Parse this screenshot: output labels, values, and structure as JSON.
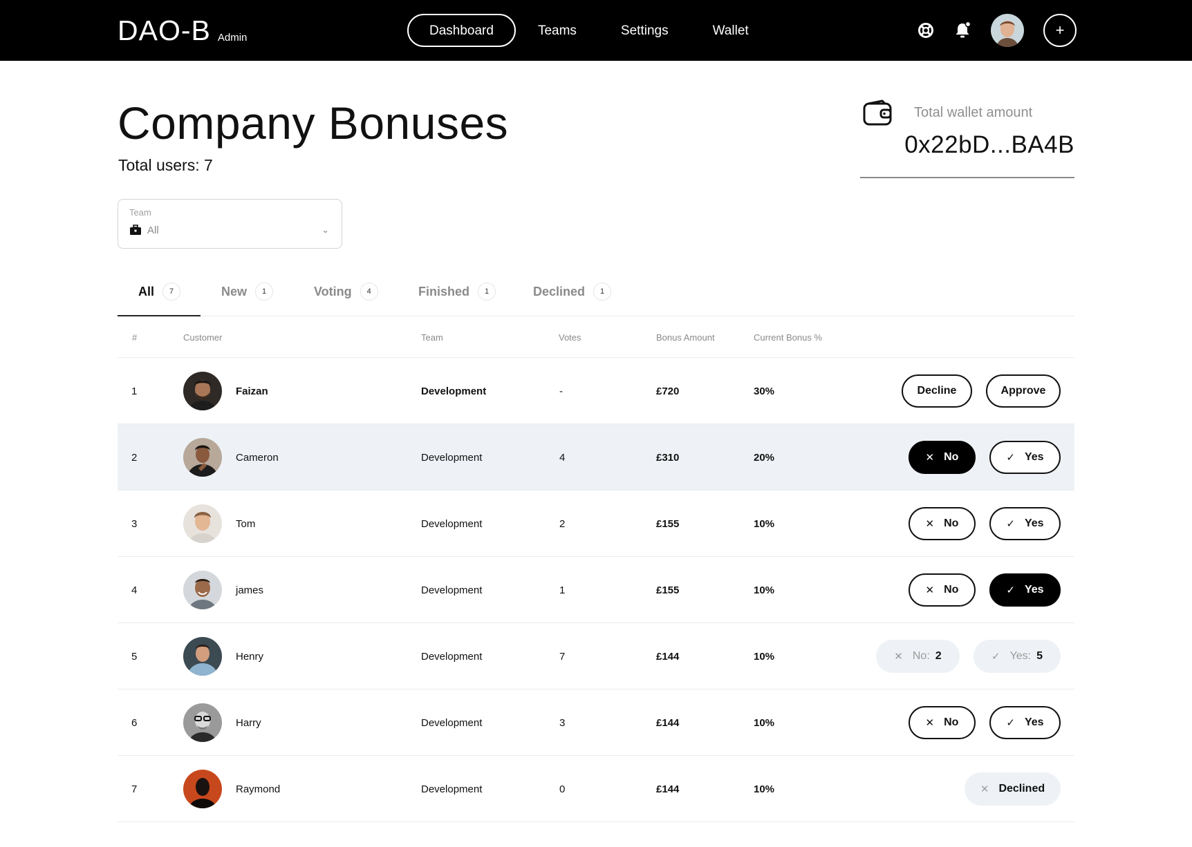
{
  "nav": {
    "logo": "DAO-B",
    "logo_sub": "Admin",
    "items": [
      {
        "label": "Dashboard",
        "active": true
      },
      {
        "label": "Teams"
      },
      {
        "label": "Settings"
      },
      {
        "label": "Wallet"
      }
    ],
    "plus": "+"
  },
  "page": {
    "title": "Company Bonuses",
    "total_users": "Total users: 7"
  },
  "wallet": {
    "label": "Total wallet amount",
    "value": "0x22bD...BA4B"
  },
  "filter": {
    "label": "Team",
    "value": "All",
    "chevron": "⌄"
  },
  "tabs": [
    {
      "label": "All",
      "count": "7",
      "active": true
    },
    {
      "label": "New",
      "count": "1"
    },
    {
      "label": "Voting",
      "count": "4"
    },
    {
      "label": "Finished",
      "count": "1"
    },
    {
      "label": "Declined",
      "count": "1"
    }
  ],
  "table": {
    "headers": [
      "#",
      "Customer",
      "Team",
      "Votes",
      "Bonus Amount",
      "Current Bonus %"
    ],
    "rows": [
      {
        "num": "1",
        "name": "Faizan",
        "team": "Development",
        "votes": "-",
        "amount": "£720",
        "pct": "30%",
        "name_bold": true,
        "action": "decision",
        "decline": "Decline",
        "approve": "Approve"
      },
      {
        "num": "2",
        "name": "Cameron",
        "team": "Development",
        "votes": "4",
        "amount": "£310",
        "pct": "20%",
        "highlight": true,
        "action": "vote",
        "selected": "no",
        "no": "No",
        "yes": "Yes"
      },
      {
        "num": "3",
        "name": "Tom",
        "team": "Development",
        "votes": "2",
        "amount": "£155",
        "pct": "10%",
        "action": "vote",
        "selected": "none",
        "no": "No",
        "yes": "Yes"
      },
      {
        "num": "4",
        "name": "james",
        "team": "Development",
        "votes": "1",
        "amount": "£155",
        "pct": "10%",
        "action": "vote",
        "selected": "yes",
        "no": "No",
        "yes": "Yes"
      },
      {
        "num": "5",
        "name": "Henry",
        "team": "Development",
        "votes": "7",
        "amount": "£144",
        "pct": "10%",
        "action": "result",
        "no": "No:",
        "no_count": "2",
        "yes": "Yes:",
        "yes_count": "5"
      },
      {
        "num": "6",
        "name": "Harry",
        "team": "Development",
        "votes": "3",
        "amount": "£144",
        "pct": "10%",
        "action": "vote",
        "selected": "none",
        "no": "No",
        "yes": "Yes"
      },
      {
        "num": "7",
        "name": "Raymond",
        "team": "Development",
        "votes": "0",
        "amount": "£144",
        "pct": "10%",
        "action": "declined",
        "declined": "Declined"
      }
    ]
  },
  "colors": {
    "topbar": "#000000",
    "highlight_row": "#eef2f6",
    "muted_text": "#8a8a8a"
  }
}
